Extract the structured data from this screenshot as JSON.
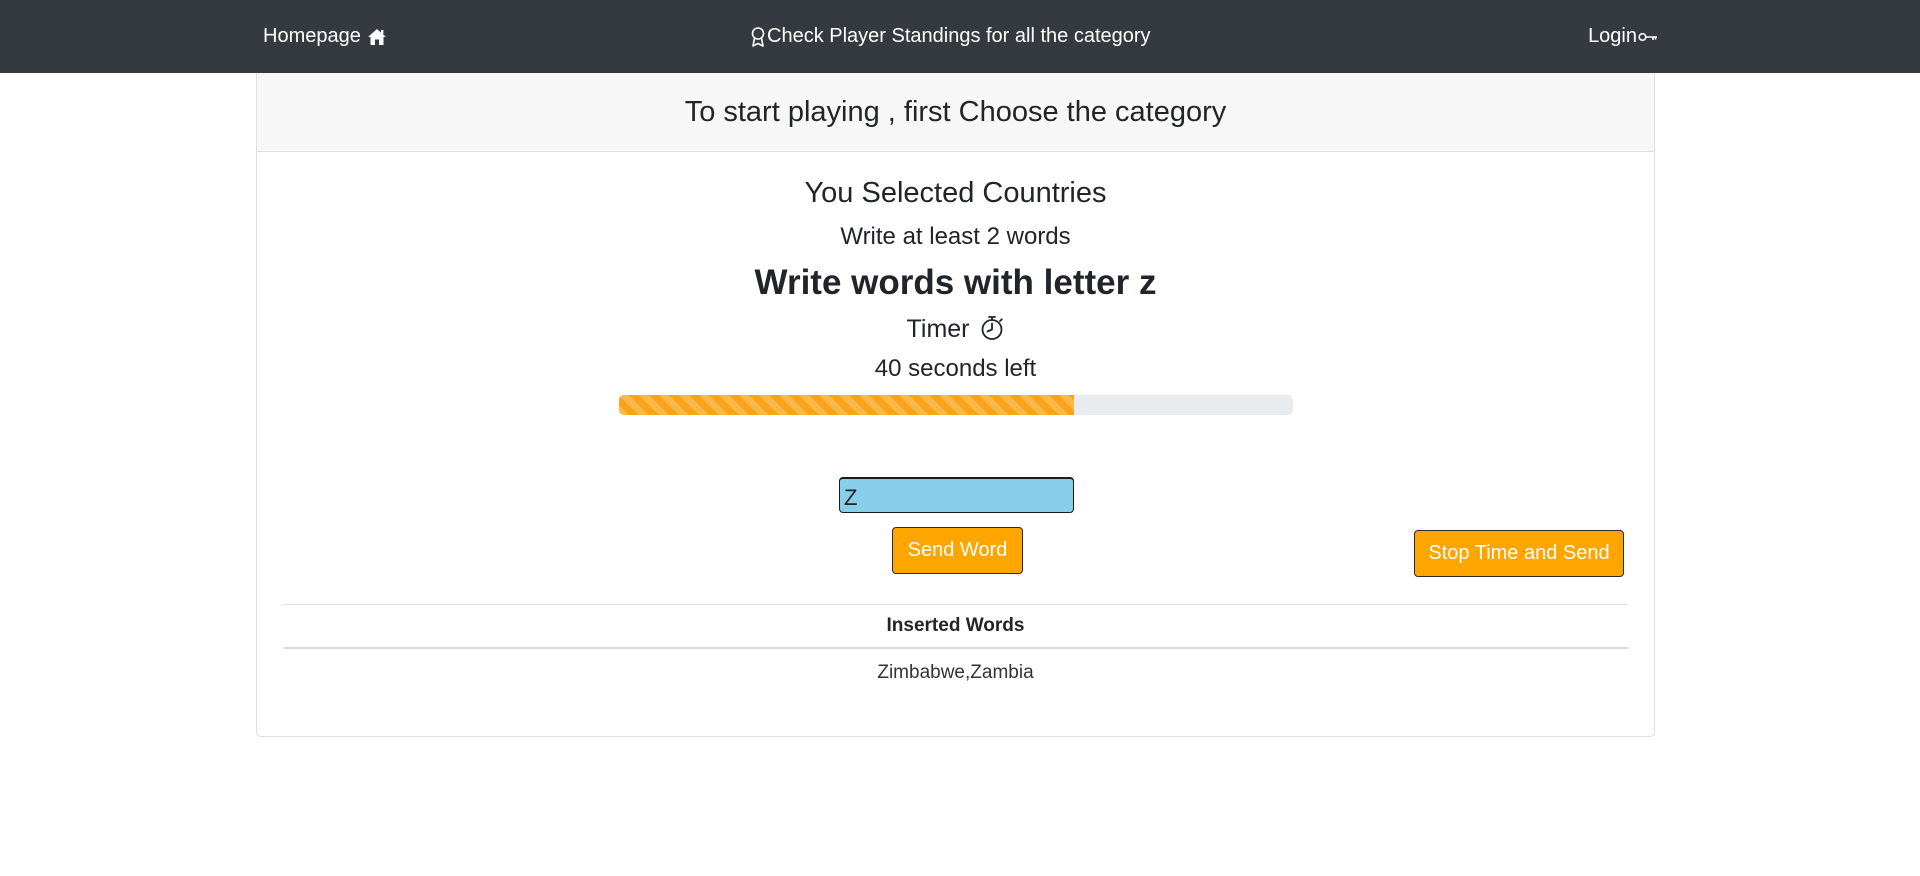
{
  "nav": {
    "home_label": "Homepage",
    "home_icon": "home-icon",
    "standings_label": "Check Player Standings for all the category",
    "standings_icon": "award-icon",
    "login_label": "Login",
    "login_icon": "key-icon"
  },
  "card": {
    "header": "To start playing , first Choose the category"
  },
  "game": {
    "selected_text": "You Selected Countries",
    "min_words_text": "Write at least 2 words",
    "letter_text": "Write words with letter z",
    "timer_label": "Timer",
    "timer_icon": "stopwatch-icon",
    "time_left_text": "40 seconds left",
    "progress_percent": 67.5,
    "input_value": "Z",
    "send_button_label": "Send Word",
    "stop_button_label": "Stop Time and Send"
  },
  "inserted_words": {
    "header": "Inserted Words",
    "rows": [
      "Zimbabwe,Zambia"
    ]
  },
  "colors": {
    "navbar": "#343a40",
    "accent": "#ffa500",
    "progress_fill": "#f9a31a",
    "input_bg": "#87ceeb"
  }
}
